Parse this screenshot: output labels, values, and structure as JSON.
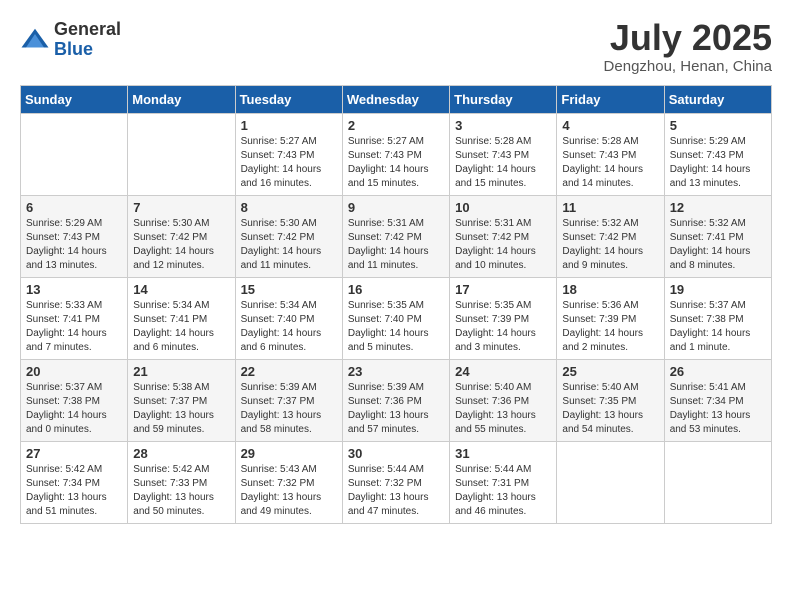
{
  "header": {
    "logo_general": "General",
    "logo_blue": "Blue",
    "month_title": "July 2025",
    "location": "Dengzhou, Henan, China"
  },
  "days_of_week": [
    "Sunday",
    "Monday",
    "Tuesday",
    "Wednesday",
    "Thursday",
    "Friday",
    "Saturday"
  ],
  "weeks": [
    [
      {
        "day": "",
        "info": ""
      },
      {
        "day": "",
        "info": ""
      },
      {
        "day": "1",
        "info": "Sunrise: 5:27 AM\nSunset: 7:43 PM\nDaylight: 14 hours\nand 16 minutes."
      },
      {
        "day": "2",
        "info": "Sunrise: 5:27 AM\nSunset: 7:43 PM\nDaylight: 14 hours\nand 15 minutes."
      },
      {
        "day": "3",
        "info": "Sunrise: 5:28 AM\nSunset: 7:43 PM\nDaylight: 14 hours\nand 15 minutes."
      },
      {
        "day": "4",
        "info": "Sunrise: 5:28 AM\nSunset: 7:43 PM\nDaylight: 14 hours\nand 14 minutes."
      },
      {
        "day": "5",
        "info": "Sunrise: 5:29 AM\nSunset: 7:43 PM\nDaylight: 14 hours\nand 13 minutes."
      }
    ],
    [
      {
        "day": "6",
        "info": "Sunrise: 5:29 AM\nSunset: 7:43 PM\nDaylight: 14 hours\nand 13 minutes."
      },
      {
        "day": "7",
        "info": "Sunrise: 5:30 AM\nSunset: 7:42 PM\nDaylight: 14 hours\nand 12 minutes."
      },
      {
        "day": "8",
        "info": "Sunrise: 5:30 AM\nSunset: 7:42 PM\nDaylight: 14 hours\nand 11 minutes."
      },
      {
        "day": "9",
        "info": "Sunrise: 5:31 AM\nSunset: 7:42 PM\nDaylight: 14 hours\nand 11 minutes."
      },
      {
        "day": "10",
        "info": "Sunrise: 5:31 AM\nSunset: 7:42 PM\nDaylight: 14 hours\nand 10 minutes."
      },
      {
        "day": "11",
        "info": "Sunrise: 5:32 AM\nSunset: 7:42 PM\nDaylight: 14 hours\nand 9 minutes."
      },
      {
        "day": "12",
        "info": "Sunrise: 5:32 AM\nSunset: 7:41 PM\nDaylight: 14 hours\nand 8 minutes."
      }
    ],
    [
      {
        "day": "13",
        "info": "Sunrise: 5:33 AM\nSunset: 7:41 PM\nDaylight: 14 hours\nand 7 minutes."
      },
      {
        "day": "14",
        "info": "Sunrise: 5:34 AM\nSunset: 7:41 PM\nDaylight: 14 hours\nand 6 minutes."
      },
      {
        "day": "15",
        "info": "Sunrise: 5:34 AM\nSunset: 7:40 PM\nDaylight: 14 hours\nand 6 minutes."
      },
      {
        "day": "16",
        "info": "Sunrise: 5:35 AM\nSunset: 7:40 PM\nDaylight: 14 hours\nand 5 minutes."
      },
      {
        "day": "17",
        "info": "Sunrise: 5:35 AM\nSunset: 7:39 PM\nDaylight: 14 hours\nand 3 minutes."
      },
      {
        "day": "18",
        "info": "Sunrise: 5:36 AM\nSunset: 7:39 PM\nDaylight: 14 hours\nand 2 minutes."
      },
      {
        "day": "19",
        "info": "Sunrise: 5:37 AM\nSunset: 7:38 PM\nDaylight: 14 hours\nand 1 minute."
      }
    ],
    [
      {
        "day": "20",
        "info": "Sunrise: 5:37 AM\nSunset: 7:38 PM\nDaylight: 14 hours\nand 0 minutes."
      },
      {
        "day": "21",
        "info": "Sunrise: 5:38 AM\nSunset: 7:37 PM\nDaylight: 13 hours\nand 59 minutes."
      },
      {
        "day": "22",
        "info": "Sunrise: 5:39 AM\nSunset: 7:37 PM\nDaylight: 13 hours\nand 58 minutes."
      },
      {
        "day": "23",
        "info": "Sunrise: 5:39 AM\nSunset: 7:36 PM\nDaylight: 13 hours\nand 57 minutes."
      },
      {
        "day": "24",
        "info": "Sunrise: 5:40 AM\nSunset: 7:36 PM\nDaylight: 13 hours\nand 55 minutes."
      },
      {
        "day": "25",
        "info": "Sunrise: 5:40 AM\nSunset: 7:35 PM\nDaylight: 13 hours\nand 54 minutes."
      },
      {
        "day": "26",
        "info": "Sunrise: 5:41 AM\nSunset: 7:34 PM\nDaylight: 13 hours\nand 53 minutes."
      }
    ],
    [
      {
        "day": "27",
        "info": "Sunrise: 5:42 AM\nSunset: 7:34 PM\nDaylight: 13 hours\nand 51 minutes."
      },
      {
        "day": "28",
        "info": "Sunrise: 5:42 AM\nSunset: 7:33 PM\nDaylight: 13 hours\nand 50 minutes."
      },
      {
        "day": "29",
        "info": "Sunrise: 5:43 AM\nSunset: 7:32 PM\nDaylight: 13 hours\nand 49 minutes."
      },
      {
        "day": "30",
        "info": "Sunrise: 5:44 AM\nSunset: 7:32 PM\nDaylight: 13 hours\nand 47 minutes."
      },
      {
        "day": "31",
        "info": "Sunrise: 5:44 AM\nSunset: 7:31 PM\nDaylight: 13 hours\nand 46 minutes."
      },
      {
        "day": "",
        "info": ""
      },
      {
        "day": "",
        "info": ""
      }
    ]
  ]
}
